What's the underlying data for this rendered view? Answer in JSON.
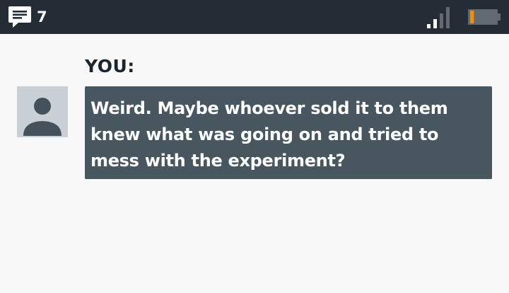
{
  "status_bar": {
    "message_icon": "chat-bubble-lines-icon",
    "message_count": "7",
    "signal_icon": "signal-strength-icon",
    "signal_level": 0.5,
    "battery_icon": "battery-icon",
    "battery_level": 0.15,
    "battery_color": "#ff8a00"
  },
  "conversation": {
    "sender_label": "YOU:",
    "avatar_icon": "default-user-avatar-icon",
    "message_text": "Weird. Maybe whoever sold it to them knew what was going on and tried to mess with the experiment?"
  },
  "colors": {
    "status_bar_bg": "#232d35",
    "page_bg": "#f8f8f8",
    "bubble_bg": "#47565f",
    "avatar_bg": "#c9d0d6",
    "label_color": "#1c252c"
  }
}
